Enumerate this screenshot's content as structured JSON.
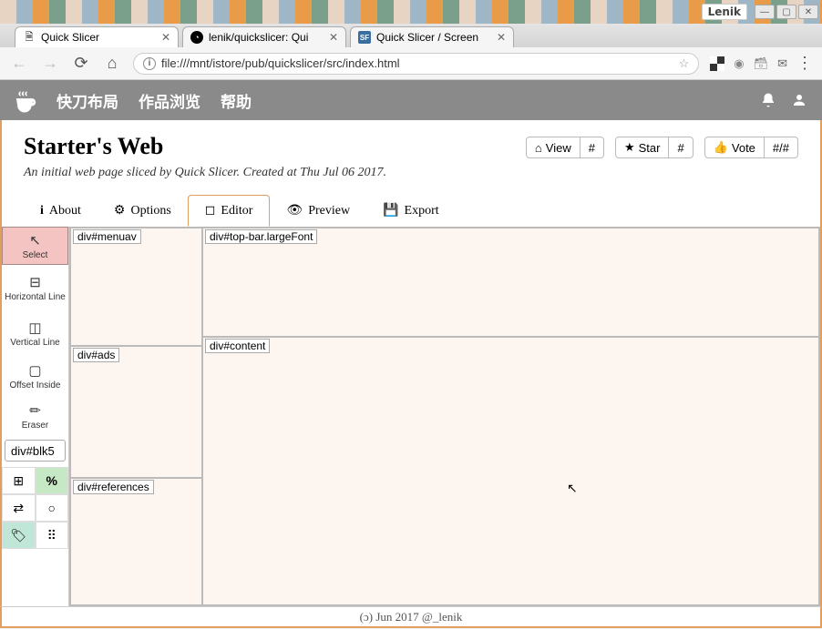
{
  "window": {
    "title_right": "Lenik"
  },
  "browser": {
    "tabs": [
      {
        "title": "Quick Slicer",
        "favicon": "doc"
      },
      {
        "title": "lenik/quickslicer: Qui",
        "favicon": "gh"
      },
      {
        "title": "Quick Slicer / Screen",
        "favicon": "sf"
      }
    ],
    "url": "file:///mnt/istore/pub/quickslicer/src/index.html"
  },
  "app": {
    "menu": [
      "快刀布局",
      "作品浏览",
      "帮助"
    ]
  },
  "page": {
    "title": "Starter's Web",
    "subtitle": "An initial web page sliced by Quick Slicer. Created at Thu Jul 06 2017.",
    "stats": {
      "view_label": "View",
      "view_count": "#",
      "star_label": "Star",
      "star_count": "#",
      "vote_label": "Vote",
      "vote_count": "#/#"
    }
  },
  "tabs": {
    "about": "About",
    "options": "Options",
    "editor": "Editor",
    "preview": "Preview",
    "export": "Export"
  },
  "tools": {
    "select": "Select",
    "hline": "Horizontal Line",
    "vline": "Vertical Line",
    "offset": "Offset Inside",
    "eraser": "Eraser",
    "selected_element": "div#blk5",
    "percent": "%"
  },
  "regions": {
    "menuav": "div#menuav",
    "topbar": "div#top-bar.largeFont",
    "content": "div#content",
    "ads": "div#ads",
    "references": "div#references"
  },
  "footer": "(ɔ) Jun 2017 @_lenik"
}
